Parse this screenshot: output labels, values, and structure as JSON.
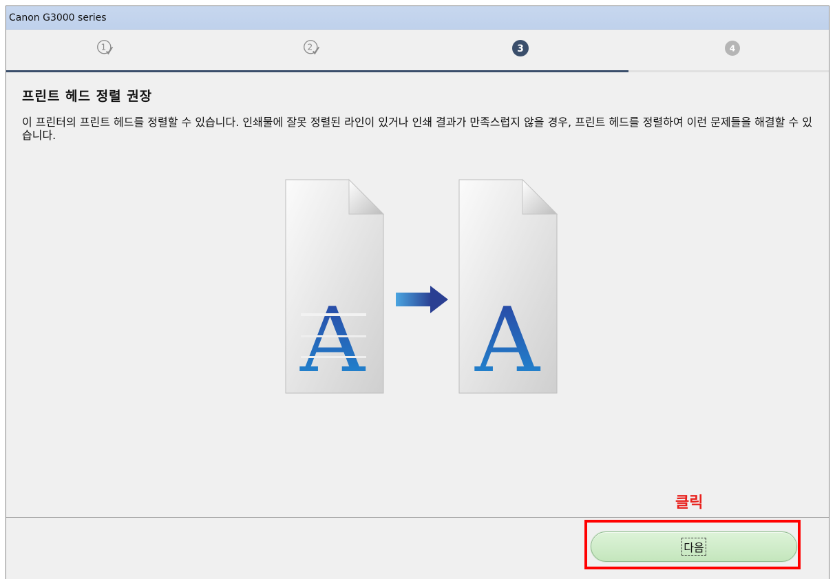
{
  "window": {
    "title": "Canon G3000 series"
  },
  "steps": [
    {
      "number": "1",
      "state": "done"
    },
    {
      "number": "2",
      "state": "done"
    },
    {
      "number": "3",
      "state": "current"
    },
    {
      "number": "4",
      "state": "pending"
    }
  ],
  "page": {
    "heading": "프린트 헤드 정렬 권장",
    "description": "이 프린터의 프린트 헤드를 정렬할 수 있습니다. 인쇄물에 잘못 정렬된 라인이 있거나 인쇄 결과가 만족스럽지 않을 경우, 프린트 헤드를 정렬하여 이런 문제들을 해결할 수 있습니다."
  },
  "illustration": {
    "before_letter": "A",
    "after_letter": "A"
  },
  "annotation": {
    "label": "클릭",
    "color": "#e8201c"
  },
  "buttons": {
    "next_label": "다음"
  },
  "colors": {
    "title_bar": "#c7d7ee",
    "step_current": "#3a4e6b",
    "step_pending": "#b5b5b5",
    "next_button": "#c4e6bd",
    "highlight": "#ff0000"
  }
}
